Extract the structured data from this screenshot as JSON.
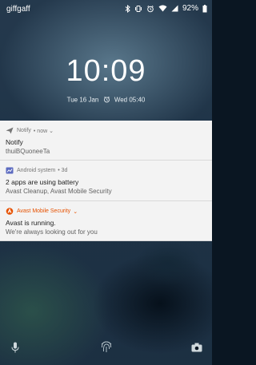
{
  "status_bar": {
    "carrier": "giffgaff",
    "battery": "92%",
    "icons": [
      "bluetooth-icon",
      "vibrate-icon",
      "alarm-icon",
      "wifi-icon",
      "signal-icon",
      "battery-icon"
    ]
  },
  "lockscreen": {
    "time": "10:09",
    "date": "Tue 16 Jan",
    "alarm": "Wed 05:40"
  },
  "notifications": [
    {
      "app_icon": "send-icon",
      "app": "Notify",
      "meta": "• now ⌄",
      "title": "Notify",
      "text": "thuiBQuoneeTa"
    },
    {
      "app_icon": "battery-app-icon",
      "app": "Android system",
      "meta": "• 3d",
      "title": "2 apps are using battery",
      "text": "Avast Cleanup, Avast Mobile Security"
    },
    {
      "app_icon": "avast-icon",
      "app": "Avast Mobile Security",
      "meta": "⌄",
      "title": "Avast is running.",
      "text": "We're always looking out for you",
      "accent": "#e65100"
    }
  ],
  "bottom_bar": {
    "icons": [
      "microphone-icon",
      "fingerprint-icon",
      "camera-icon"
    ]
  }
}
